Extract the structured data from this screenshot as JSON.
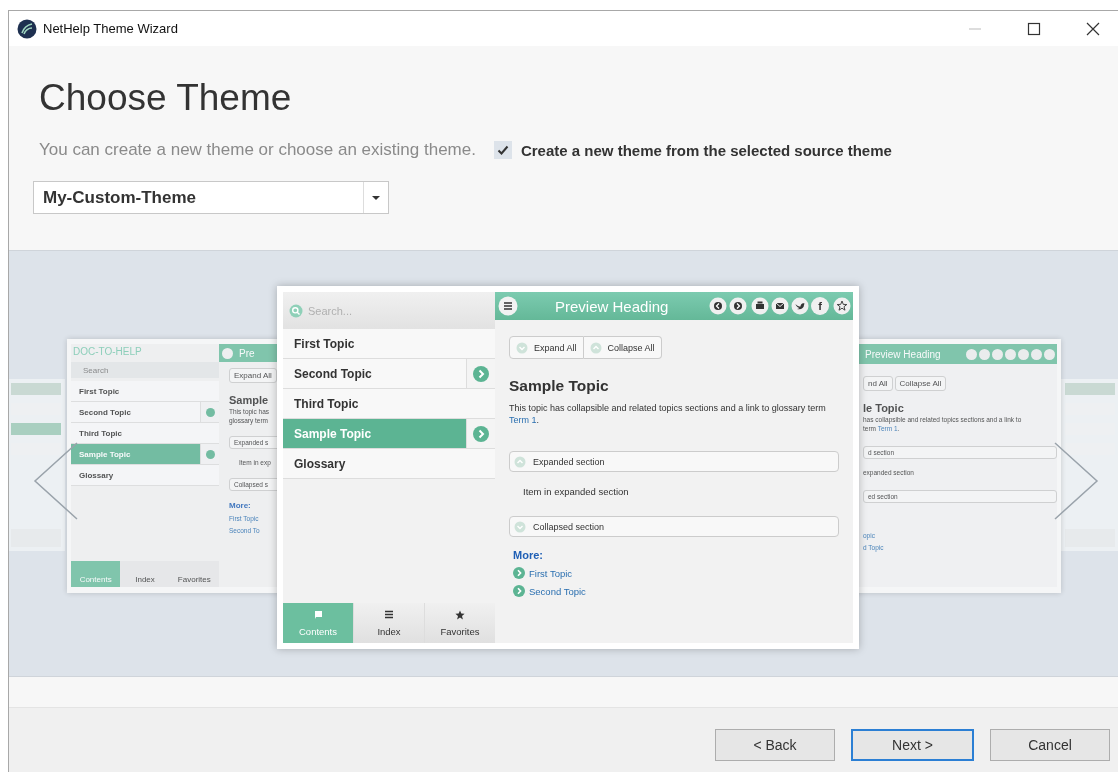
{
  "window": {
    "title": "NetHelp Theme Wizard"
  },
  "heading": "Choose Theme",
  "description": "You can create a new theme or choose an existing theme.",
  "create_new": {
    "label": "Create a new theme from the selected source theme",
    "checked": true
  },
  "theme_select": {
    "value": "My-Custom-Theme"
  },
  "preview": {
    "search_placeholder": "Search...",
    "topics": [
      {
        "label": "First Topic",
        "selected": false,
        "expandable": false
      },
      {
        "label": "Second Topic",
        "selected": false,
        "expandable": true
      },
      {
        "label": "Third Topic",
        "selected": false,
        "expandable": false
      },
      {
        "label": "Sample Topic",
        "selected": true,
        "expandable": true
      },
      {
        "label": "Glossary",
        "selected": false,
        "expandable": false
      }
    ],
    "heading": "Preview Heading",
    "facebook_glyph": "f",
    "expand_all": "Expand All",
    "collapse_all": "Collapse All",
    "topic_title": "Sample Topic",
    "topic_text": "This topic has collapsible and related topics sections and a link to glossary term",
    "link": "Term 1",
    "text_end": ".",
    "sections": [
      {
        "label": "Expanded section",
        "expanded": true,
        "items": [
          "Item in expanded section"
        ]
      },
      {
        "label": "Collapsed section",
        "expanded": false
      }
    ],
    "more_label": "More:",
    "related": [
      "First Topic",
      "Second Topic"
    ],
    "tabs": [
      {
        "label": "Contents",
        "selected": true
      },
      {
        "label": "Index",
        "selected": false
      },
      {
        "label": "Favorites",
        "selected": false
      }
    ]
  },
  "left_preview": {
    "logo": "DOC-TO-HELP",
    "heading": "Pre",
    "search_placeholder": "Search",
    "topics": [
      {
        "label": "First Topic",
        "selected": false,
        "expandable": false
      },
      {
        "label": "Second Topic",
        "selected": false,
        "expandable": true
      },
      {
        "label": "Third Topic",
        "selected": false,
        "expandable": false
      },
      {
        "label": "Sample Topic",
        "selected": true,
        "expandable": true
      },
      {
        "label": "Glossary",
        "selected": false,
        "expandable": false
      }
    ],
    "expand_all": "Expand All",
    "topic_title": "Sample",
    "topic_lines": [
      "This topic has",
      "glossary term"
    ],
    "sections": [
      {
        "label": "Expanded s",
        "items": [
          "Item in exp"
        ]
      },
      {
        "label": "Collapsed s"
      }
    ],
    "more_label": "More:",
    "related": [
      "First Topic",
      "Second To"
    ],
    "tabs": [
      {
        "label": "Contents",
        "selected": true
      },
      {
        "label": "Index",
        "selected": false
      },
      {
        "label": "Favorites",
        "selected": false
      }
    ]
  },
  "right_preview": {
    "heading": "Preview Heading",
    "expand_all": "nd All",
    "collapse_all": "Collapse All",
    "topic_title": "le Topic",
    "topic_text": "has collapsible and related topics sections and a link to",
    "glossary_text": "term",
    "link": "Term 1",
    "text_end": ".",
    "sections": [
      {
        "label": "d section",
        "items": [
          "expanded section"
        ]
      },
      {
        "label": "ed section"
      }
    ],
    "related": [
      "opic",
      "d Topic"
    ]
  },
  "buttons": [
    {
      "label": "< Back",
      "default": false
    },
    {
      "label": "Next >",
      "default": true
    },
    {
      "label": "Cancel",
      "default": false
    }
  ]
}
